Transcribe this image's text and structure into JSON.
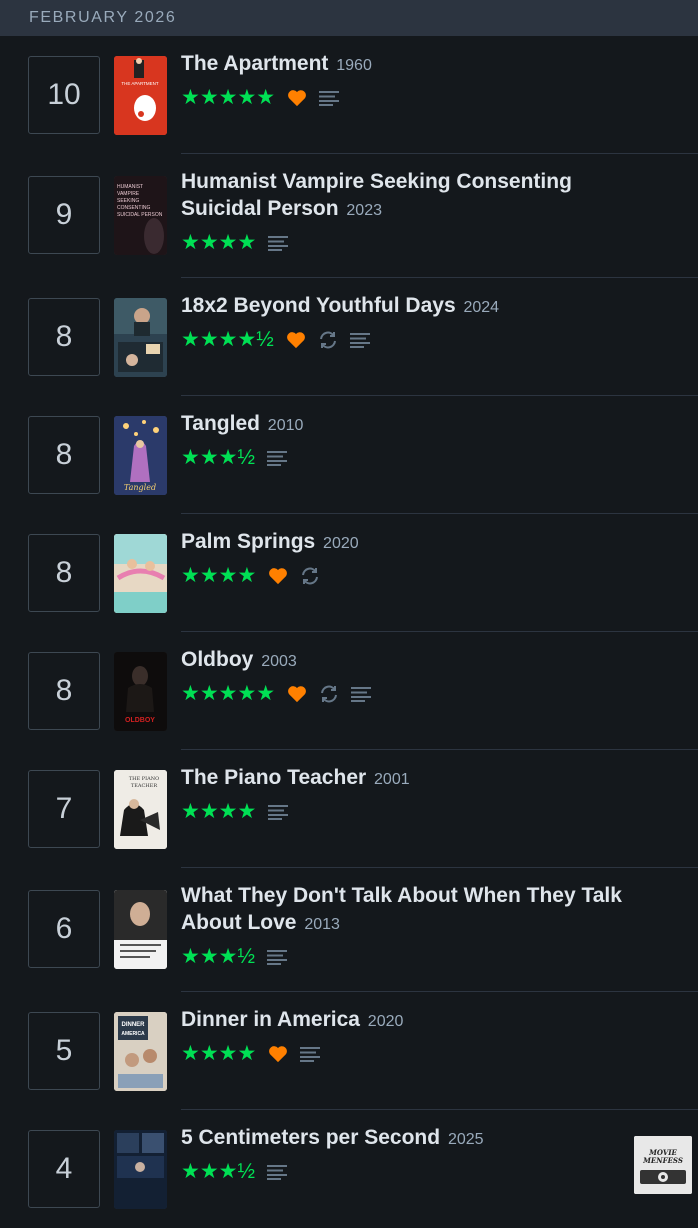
{
  "header": {
    "month": "FEBRUARY 2026"
  },
  "entries": [
    {
      "day": "10",
      "title": "The Apartment",
      "year": "1960",
      "stars": "★★★★★",
      "liked": true,
      "rewatch": false,
      "review": true
    },
    {
      "day": "9",
      "title": "Humanist Vampire Seeking Consenting Suicidal Person",
      "year": "2023",
      "stars": "★★★★",
      "liked": false,
      "rewatch": false,
      "review": true
    },
    {
      "day": "8",
      "title": "18x2 Beyond Youthful Days",
      "year": "2024",
      "stars": "★★★★½",
      "liked": true,
      "rewatch": true,
      "review": true
    },
    {
      "day": "8",
      "title": "Tangled",
      "year": "2010",
      "stars": "★★★½",
      "liked": false,
      "rewatch": false,
      "review": true
    },
    {
      "day": "8",
      "title": "Palm Springs",
      "year": "2020",
      "stars": "★★★★",
      "liked": true,
      "rewatch": true,
      "review": false
    },
    {
      "day": "8",
      "title": "Oldboy",
      "year": "2003",
      "stars": "★★★★★",
      "liked": true,
      "rewatch": true,
      "review": true
    },
    {
      "day": "7",
      "title": "The Piano Teacher",
      "year": "2001",
      "stars": "★★★★",
      "liked": false,
      "rewatch": false,
      "review": true
    },
    {
      "day": "6",
      "title": "What They Don't Talk About When They Talk About Love",
      "year": "2013",
      "stars": "★★★½",
      "liked": false,
      "rewatch": false,
      "review": true
    },
    {
      "day": "5",
      "title": "Dinner in America",
      "year": "2020",
      "stars": "★★★★",
      "liked": true,
      "rewatch": false,
      "review": true
    },
    {
      "day": "4",
      "title": "5 Centimeters per Second",
      "year": "2025",
      "stars": "★★★½",
      "liked": false,
      "rewatch": false,
      "review": true
    }
  ],
  "posters": [
    {
      "text": "THE APARTMENT",
      "bg": "#d8361f"
    },
    {
      "text": "HUMANIST VAMPIRE SEEKING CONSENTING SUICIDAL PERSON",
      "bg": "#1e1418"
    },
    {
      "text": "",
      "bg": "#2d4250"
    },
    {
      "text": "Tangled",
      "bg": "#2b3a6a"
    },
    {
      "text": "",
      "bg": "#e7d8c4"
    },
    {
      "text": "OLDBOY",
      "bg": "#0e0c0c"
    },
    {
      "text": "THE PIANO TEACHER",
      "bg": "#efece6"
    },
    {
      "text": "",
      "bg": "#f2f2f2"
    },
    {
      "text": "DINNER IN AMERICA",
      "bg": "#d9d0c2"
    },
    {
      "text": "",
      "bg": "#132033"
    }
  ],
  "watermark": {
    "text": "MOVIE MENFESS"
  },
  "colors": {
    "star": "#00e054",
    "like": "#ff8000",
    "icon": "#678",
    "background": "#14181c"
  }
}
